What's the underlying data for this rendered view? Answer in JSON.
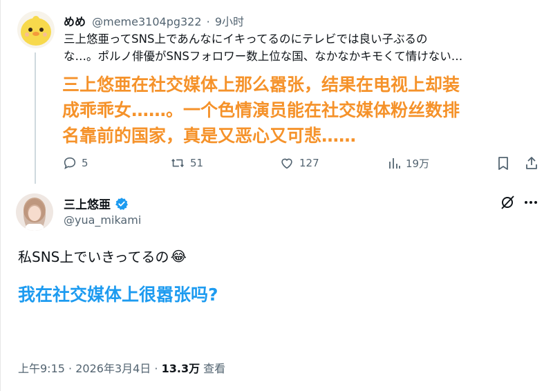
{
  "parent_tweet": {
    "display_name": "めめ",
    "handle": "@meme3104pg322",
    "separator": "·",
    "time_ago": "9小时",
    "text_lines": [
      "三上悠亜ってSNS上であんなにイキってるのにテレビでは良い子ぶるの",
      "な…。ポルノ俳優がSNSフォロワー数上位な国、なかなかキモくて情けない…"
    ],
    "translation_lines": [
      "三上悠亜在社交媒体上那么嚣张，结果在电视上却装",
      "成乖乖女……。一个色情演员能在社交媒体粉丝数排",
      "名靠前的国家，真是又恶心又可悲……"
    ],
    "actions": {
      "replies": "5",
      "reposts": "51",
      "likes": "127",
      "views": "19万"
    },
    "avatar_icon": "chick-avatar-icon"
  },
  "main_tweet": {
    "display_name": "三上悠亜",
    "verified_icon": "verified-badge-icon",
    "handle": "@yua_mikami",
    "text": "私SNS上でいきってるの",
    "emoji": "😂",
    "translation": "我在社交媒体上很嚣张吗?",
    "footer": {
      "time": "上午9:15",
      "sep1": "·",
      "date": "2026年3月4日",
      "sep2": "·",
      "views_count": "13.3万",
      "views_label": "查看"
    }
  },
  "colors": {
    "orange_translation": "#f5922a",
    "blue_translation": "#1d9bf0",
    "verified_blue": "#1d9bf0",
    "muted_gray": "#536471",
    "thread_line": "#cfd9de"
  }
}
